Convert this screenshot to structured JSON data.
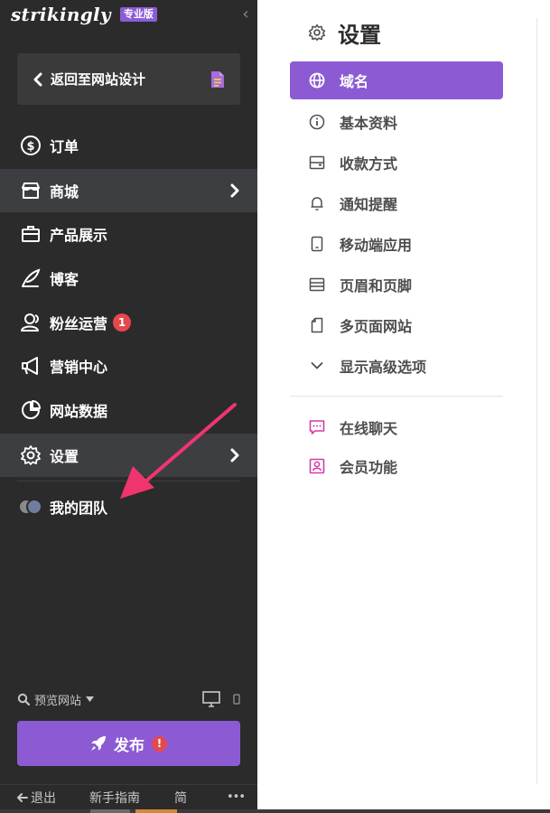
{
  "brand": {
    "name": "strikingly",
    "badge": "专业版"
  },
  "sidebar": {
    "back_label": "返回至网站设计",
    "items": [
      {
        "label": "订单",
        "icon": "dollar-circle-icon",
        "active": false
      },
      {
        "label": "商城",
        "icon": "store-icon",
        "active": true
      },
      {
        "label": "产品展示",
        "icon": "briefcase-icon",
        "active": false
      },
      {
        "label": "博客",
        "icon": "quill-icon",
        "active": false
      },
      {
        "label": "粉丝运营",
        "icon": "users-icon",
        "active": false,
        "badge": "1"
      },
      {
        "label": "营销中心",
        "icon": "megaphone-icon",
        "active": false
      },
      {
        "label": "网站数据",
        "icon": "pie-chart-icon",
        "active": false
      },
      {
        "label": "设置",
        "icon": "gear-icon",
        "active": true
      }
    ],
    "team_label": "我的团队",
    "preview_label": "预览网站",
    "publish_label": "发布",
    "publish_warning": "!",
    "footer": {
      "exit": "退出",
      "guide": "新手指南",
      "lang": "简",
      "more": "•••"
    }
  },
  "settings": {
    "title": "设置",
    "menu": [
      {
        "label": "域名",
        "icon": "globe-icon",
        "active": true
      },
      {
        "label": "基本资料",
        "icon": "info-icon",
        "active": false
      },
      {
        "label": "收款方式",
        "icon": "wallet-icon",
        "active": false
      },
      {
        "label": "通知提醒",
        "icon": "bell-icon",
        "active": false
      },
      {
        "label": "移动端应用",
        "icon": "mobile-icon",
        "active": false
      },
      {
        "label": "页眉和页脚",
        "icon": "layout-icon",
        "active": false
      },
      {
        "label": "多页面网站",
        "icon": "pages-icon",
        "active": false
      },
      {
        "label": "显示高级选项",
        "icon": "chevron-down-icon",
        "active": false
      }
    ],
    "extras": [
      {
        "label": "在线聊天",
        "icon": "chat-icon"
      },
      {
        "label": "会员功能",
        "icon": "member-icon"
      }
    ]
  },
  "colors": {
    "sidebar_bg": "#2b2b2c",
    "accent_purple": "#8c5bd4",
    "badge_red": "#e5484d",
    "annotation_arrow": "#f0356e",
    "extra_icon_pink": "#d63aa6"
  }
}
